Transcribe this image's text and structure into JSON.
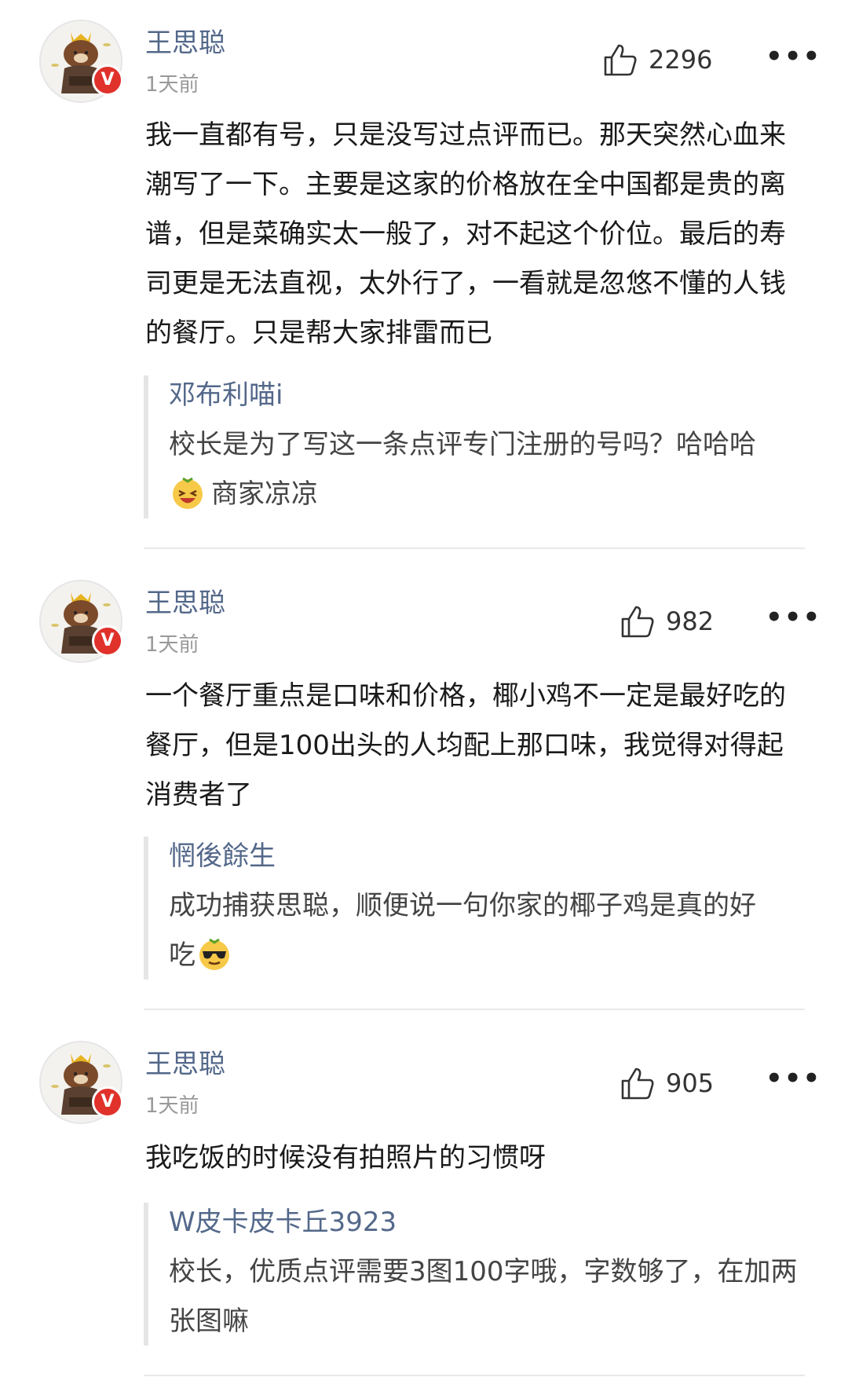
{
  "comments": [
    {
      "author": "王思聪",
      "time": "1天前",
      "likes": "2296",
      "badge": "V",
      "text": "我一直都有号，只是没写过点评而已。那天突然心血来潮写了一下。主要是这家的价格放在全中国都是贵的离谱，但是菜确实太一般了，对不起这个价位。最后的寿司更是无法直视，太外行了，一看就是忽悠不懂的人钱的餐厅。只是帮大家排雷而已",
      "reply": {
        "author": "邓布利喵i",
        "text_1": "校长是为了写这一条点评专门注册的号吗？哈哈哈",
        "text_2": "商家凉凉"
      }
    },
    {
      "author": "王思聪",
      "time": "1天前",
      "likes": "982",
      "badge": "V",
      "text": "一个餐厅重点是口味和价格，椰小鸡不一定是最好吃的餐厅，但是100出头的人均配上那口味，我觉得对得起消费者了",
      "reply": {
        "author": "惘後餘生",
        "text_1": "成功捕获思聪，顺便说一句你家的椰子鸡是真的好",
        "text_2": "吃"
      }
    },
    {
      "author": "王思聪",
      "time": "1天前",
      "likes": "905",
      "badge": "V",
      "text": "我吃饭的时候没有拍照片的习惯呀",
      "reply": {
        "author": "W皮卡皮卡丘3923",
        "text_1": "校长，优质点评需要3图100字哦，字数够了，在加两张图嘛"
      }
    }
  ],
  "icons": {
    "like": "thumbs-up-icon",
    "more": "more-dots-icon",
    "verified": "verified-badge-icon",
    "emoji_1": "laughing-tears-emoji",
    "emoji_2": "sunglasses-emoji"
  },
  "colors": {
    "name": "#53688a",
    "badge": "#e0312b",
    "time": "#999999"
  }
}
